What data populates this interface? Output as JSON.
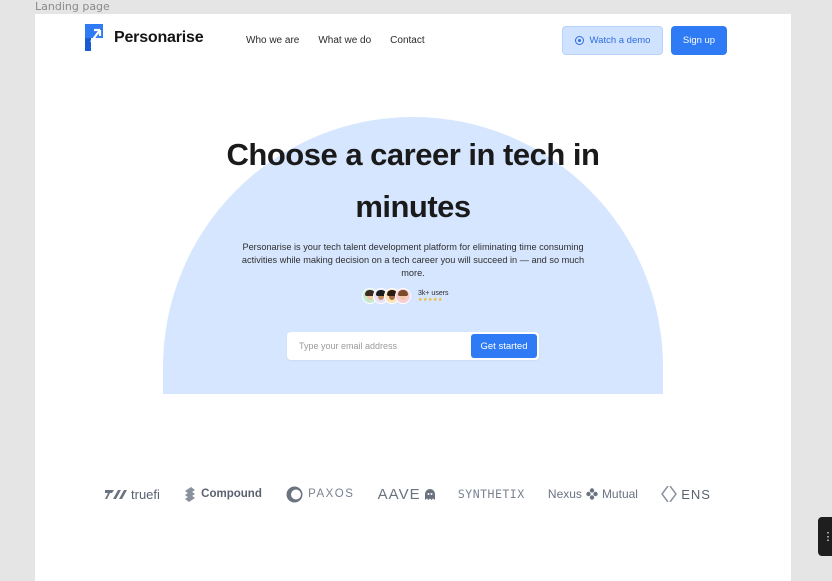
{
  "canvas": {
    "frame_label": "Landing page"
  },
  "header": {
    "brand": "Personarise",
    "nav": [
      "Who we are",
      "What we do",
      "Contact"
    ],
    "demo_label": "Watch a demo",
    "signup_label": "Sign up"
  },
  "hero": {
    "title_line1": "Choose a career in tech in",
    "title_line2": "minutes",
    "subtitle": "Personarise is your tech talent development platform for eliminating time consuming activities while making decision on a tech career you will succeed in — and so much more.",
    "users_count": "3k+ users",
    "rating_stars": "★★★★★",
    "email_placeholder": "Type your email address",
    "cta_label": "Get started"
  },
  "partners": [
    "truefi",
    "Compound",
    "PAXOS",
    "AAVE",
    "SYNTHETIX",
    "Nexus",
    "Mutual",
    "ENS"
  ],
  "colors": {
    "accent": "#2e7bf5",
    "hero_bg": "#d6e6ff",
    "demo_bg": "#cfe2ff",
    "text": "#1a1a1a"
  },
  "side_tab_icon": "panel-toggle-icon"
}
